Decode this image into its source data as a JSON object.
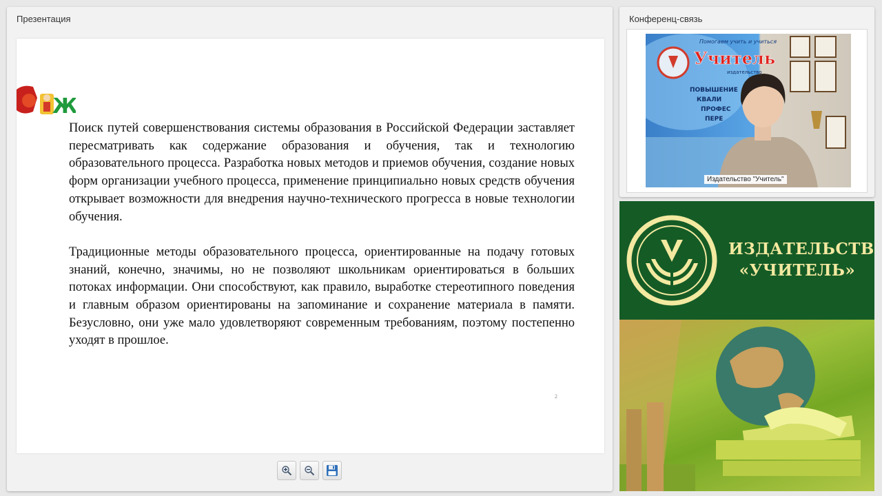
{
  "presentation": {
    "title": "Презентация",
    "slide": {
      "paragraphs": [
        "Поиск путей совершенствования системы образования в Российской Федерации заставляет пересматривать как содержание образования и обучения, так и технологию образовательного процесса. Разработка новых методов и приемов обучения, создание новых форм организации учебного процесса, применение принципиально новых средств обучения открывает возможности для внедрения научно-технического прогресса в новые технологии обучения.",
        "Традиционные методы образовательного процесса, ориентированные на подачу готовых знаний, конечно, значимы, но не позволяют школьникам ориентироваться в больших потоках информации. Они способствуют, как правило, выработке стереотипного поведения и главным образом ориентированы на запоминание и сохранение материала в памяти. Безусловно, они уже мало удовлетворяют современным требованиям, поэтому постепенно уходят в прошлое."
      ],
      "page_number": "2",
      "logo_text": "БЖ"
    },
    "toolbar": {
      "zoom_in_icon": "zoom-in-icon",
      "zoom_out_icon": "zoom-out-icon",
      "save_icon": "floppy-disk-icon"
    }
  },
  "conference": {
    "title": "Конференц-связь",
    "participant_label": "Издательство \"Учитель\"",
    "backdrop_text": {
      "slogan": "Помогаем учить и учиться",
      "brand": "Учитель",
      "brand_sub": "издательство",
      "items": [
        "ПОВЫШЕНИЕ",
        "КВАЛИ",
        "ПРОФЕС",
        "ПЕРЕ"
      ]
    }
  },
  "banner": {
    "line1": "ИЗДАТЕЛЬСТВО",
    "line2": "«УЧИТЕЛЬ»",
    "colors": {
      "green": "#155b26",
      "cream": "#f3e9a0"
    }
  }
}
